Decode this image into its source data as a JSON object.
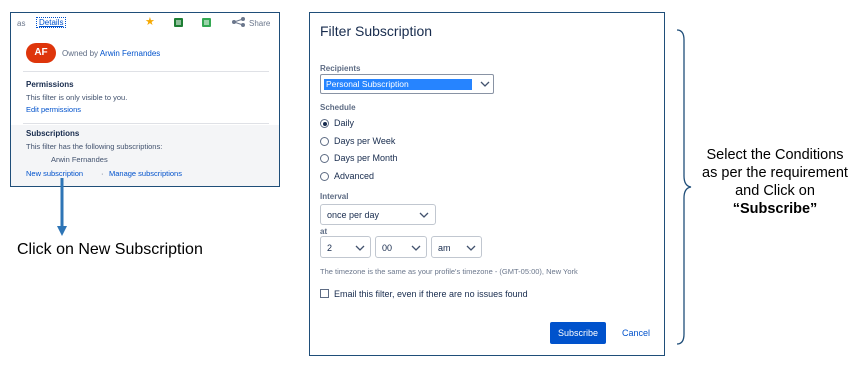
{
  "left_panel": {
    "as_text": "as",
    "details_link": "Details",
    "share_label": "Share",
    "avatar_initials": "AF",
    "owned_by_text": "Owned by",
    "owner_name": "Arwin Fernandes",
    "permissions": {
      "heading": "Permissions",
      "text": "This filter is only visible to you.",
      "edit_link": "Edit permissions"
    },
    "subscriptions": {
      "heading": "Subscriptions",
      "text": "This filter has the following subscriptions:",
      "subscriber": "Arwin Fernandes",
      "new_link": "New subscription",
      "separator": "·",
      "manage_link": "Manage subscriptions"
    }
  },
  "left_caption": "Click on New Subscription",
  "dialog": {
    "title": "Filter Subscription",
    "recipients_label": "Recipients",
    "recipients_value": "Personal Subscription",
    "schedule_label": "Schedule",
    "schedule_options": [
      {
        "label": "Daily",
        "checked": true
      },
      {
        "label": "Days per Week",
        "checked": false
      },
      {
        "label": "Days per Month",
        "checked": false
      },
      {
        "label": "Advanced",
        "checked": false
      }
    ],
    "interval_label": "Interval",
    "interval_value": "once per day",
    "at_label": "at",
    "hour_value": "2",
    "minute_value": "00",
    "ampm_value": "am",
    "timezone_note": "The timezone is the same as your profile's timezone - (GMT-05:00), New York",
    "email_checkbox_label": "Email this filter, even if there are no issues found",
    "email_checked": false,
    "subscribe_label": "Subscribe",
    "cancel_label": "Cancel"
  },
  "right_caption": {
    "line1": "Select the Conditions",
    "line2": "as  per the requirement",
    "line3": "and Click on",
    "line4": "“Subscribe”"
  },
  "colors": {
    "accent_blue": "#0052cc",
    "avatar_red": "#de350b",
    "panel_border": "#1f4e79",
    "selection_blue": "#2684ff"
  }
}
